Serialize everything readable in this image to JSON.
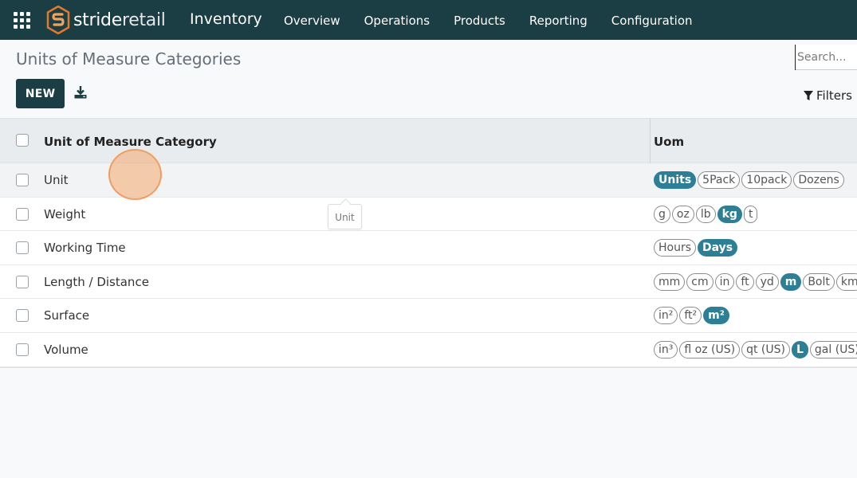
{
  "nav": {
    "brand_part1": "stride",
    "brand_part2": "retail",
    "app_name": "Inventory",
    "menu": [
      "Overview",
      "Operations",
      "Products",
      "Reporting",
      "Configuration"
    ]
  },
  "control": {
    "title": "Units of Measure Categories",
    "new_label": "NEW",
    "search_placeholder": "Search...",
    "filters_label": "Filters"
  },
  "table": {
    "headers": {
      "category": "Unit of Measure Category",
      "uom": "Uom"
    },
    "rows": [
      {
        "name": "Unit",
        "tags": [
          {
            "t": "Units",
            "active": true
          },
          {
            "t": "5Pack",
            "active": false
          },
          {
            "t": "10pack",
            "active": false
          },
          {
            "t": "Dozens",
            "active": false
          }
        ]
      },
      {
        "name": "Weight",
        "tags": [
          {
            "t": "g",
            "active": false
          },
          {
            "t": "oz",
            "active": false
          },
          {
            "t": "lb",
            "active": false
          },
          {
            "t": "kg",
            "active": true
          },
          {
            "t": "t",
            "active": false
          }
        ]
      },
      {
        "name": "Working Time",
        "tags": [
          {
            "t": "Hours",
            "active": false
          },
          {
            "t": "Days",
            "active": true
          }
        ]
      },
      {
        "name": "Length / Distance",
        "tags": [
          {
            "t": "mm",
            "active": false
          },
          {
            "t": "cm",
            "active": false
          },
          {
            "t": "in",
            "active": false
          },
          {
            "t": "ft",
            "active": false
          },
          {
            "t": "yd",
            "active": false
          },
          {
            "t": "m",
            "active": true
          },
          {
            "t": "Bolt",
            "active": false
          },
          {
            "t": "km",
            "active": false
          }
        ]
      },
      {
        "name": "Surface",
        "tags": [
          {
            "t": "in²",
            "active": false
          },
          {
            "t": "ft²",
            "active": false
          },
          {
            "t": "m²",
            "active": true
          }
        ]
      },
      {
        "name": "Volume",
        "tags": [
          {
            "t": "in³",
            "active": false
          },
          {
            "t": "fl oz (US)",
            "active": false
          },
          {
            "t": "qt (US)",
            "active": false
          },
          {
            "t": "L",
            "active": true
          },
          {
            "t": "gal (US)",
            "active": false
          }
        ]
      }
    ]
  },
  "tooltip": "Unit",
  "colors": {
    "navbar": "#1b3d44",
    "tag_active": "#2c7f95",
    "brand_orange": "#e5792b"
  }
}
